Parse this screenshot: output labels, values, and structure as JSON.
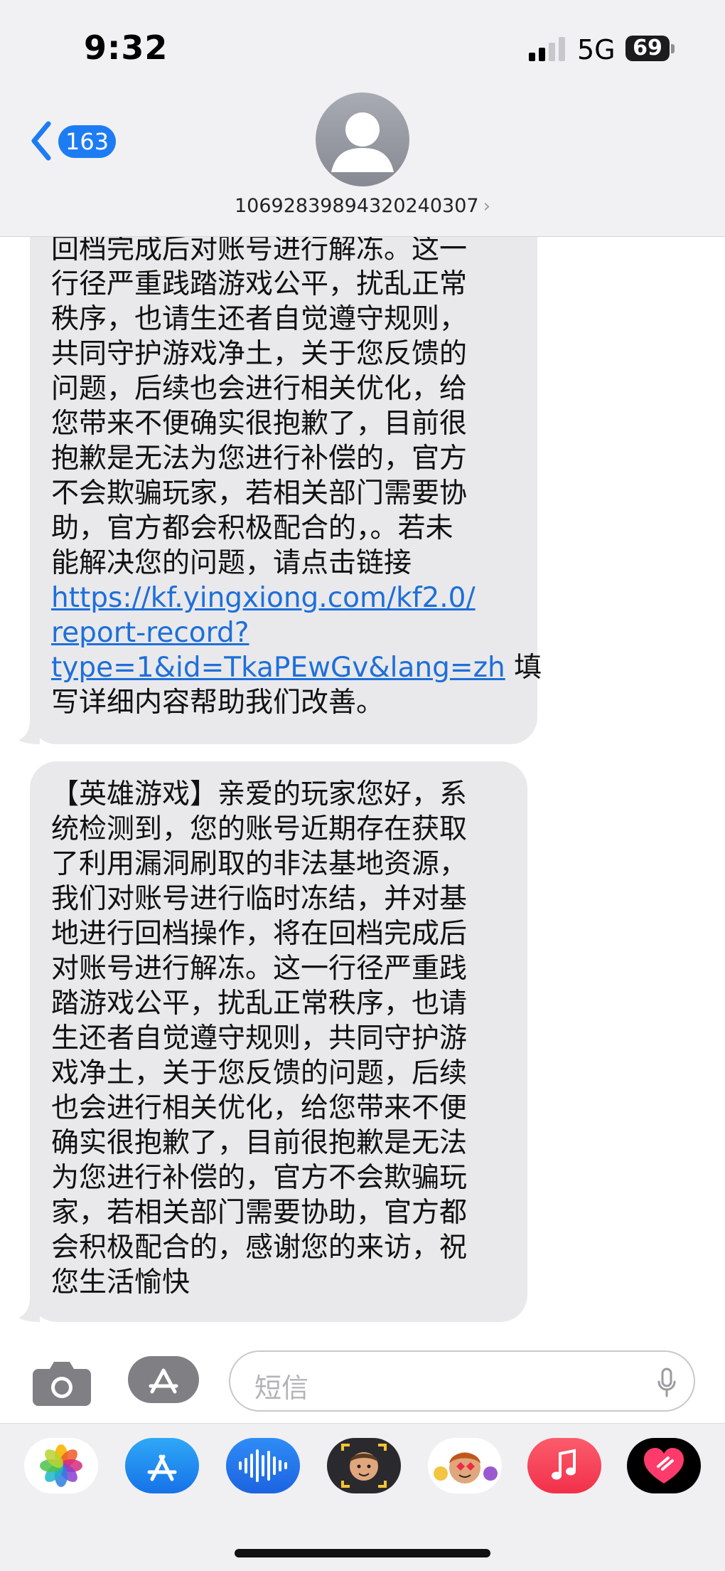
{
  "status": {
    "time": "9:32",
    "network": "5G",
    "battery": "69"
  },
  "header": {
    "back_badge": "163",
    "contact": "1069283989432024​0307"
  },
  "messages": [
    {
      "lines": [
        "回档完成后对账号进行解冻。这一",
        "行径严重践踏游戏公平，扰乱正常",
        "秩序，也请生还者自觉遵守规则，",
        "共同守护游戏净土，关于您反馈的",
        "问题，后续也会进行相关优化，给",
        "您带来不便确实很抱歉了，目前很",
        "抱歉是无法为您进行补偿的，官方",
        "不会欺骗玩家，若相关部门需要协",
        "助，官方都会积极配合的，。若未",
        "能解决您的问题，请点击链接"
      ],
      "link_lines": [
        "https://kf.yingxiong.com/kf2.0/",
        "report-record?",
        "type=1&id=TkaPEwGv&lang=zh"
      ],
      "after_link": " 填",
      "tail_line": "写详细内容帮助我们改善。"
    },
    {
      "lines": [
        "【英雄游戏】亲爱的玩家您好，系",
        "统检测到，您的账号近期存在获取",
        "了利用漏洞刷取的非法基地资源，",
        "我们对账号进行临时冻结，并对基",
        "地进行回档操作，将在回档完成后",
        "对账号进行解冻。这一行径严重践",
        "踏游戏公平，扰乱正常秩序，也请",
        "生还者自觉遵守规则，共同守护游",
        "戏净土，关于您反馈的问题，后续",
        "也会进行相关优化，给您带来不便",
        "确实很抱歉了，目前很抱歉是无法",
        "为您进行补偿的，官方不会欺骗玩",
        "家，若相关部门需要协助，官方都",
        "会积极配合的，感谢您的来访，祝",
        "您生活愉快"
      ]
    }
  ],
  "composer": {
    "placeholder": "短信"
  },
  "dock_apps": [
    "photos-app-icon",
    "app-store-app-icon",
    "audio-app-icon",
    "memoji-app-icon",
    "animoji-app-icon",
    "music-app-icon",
    "digital-touch-app-icon"
  ],
  "colors": {
    "link": "#1e6fd9",
    "badge": "#1e7cf3",
    "bubble": "#e9e9eb",
    "music": "#fb3c4e"
  }
}
